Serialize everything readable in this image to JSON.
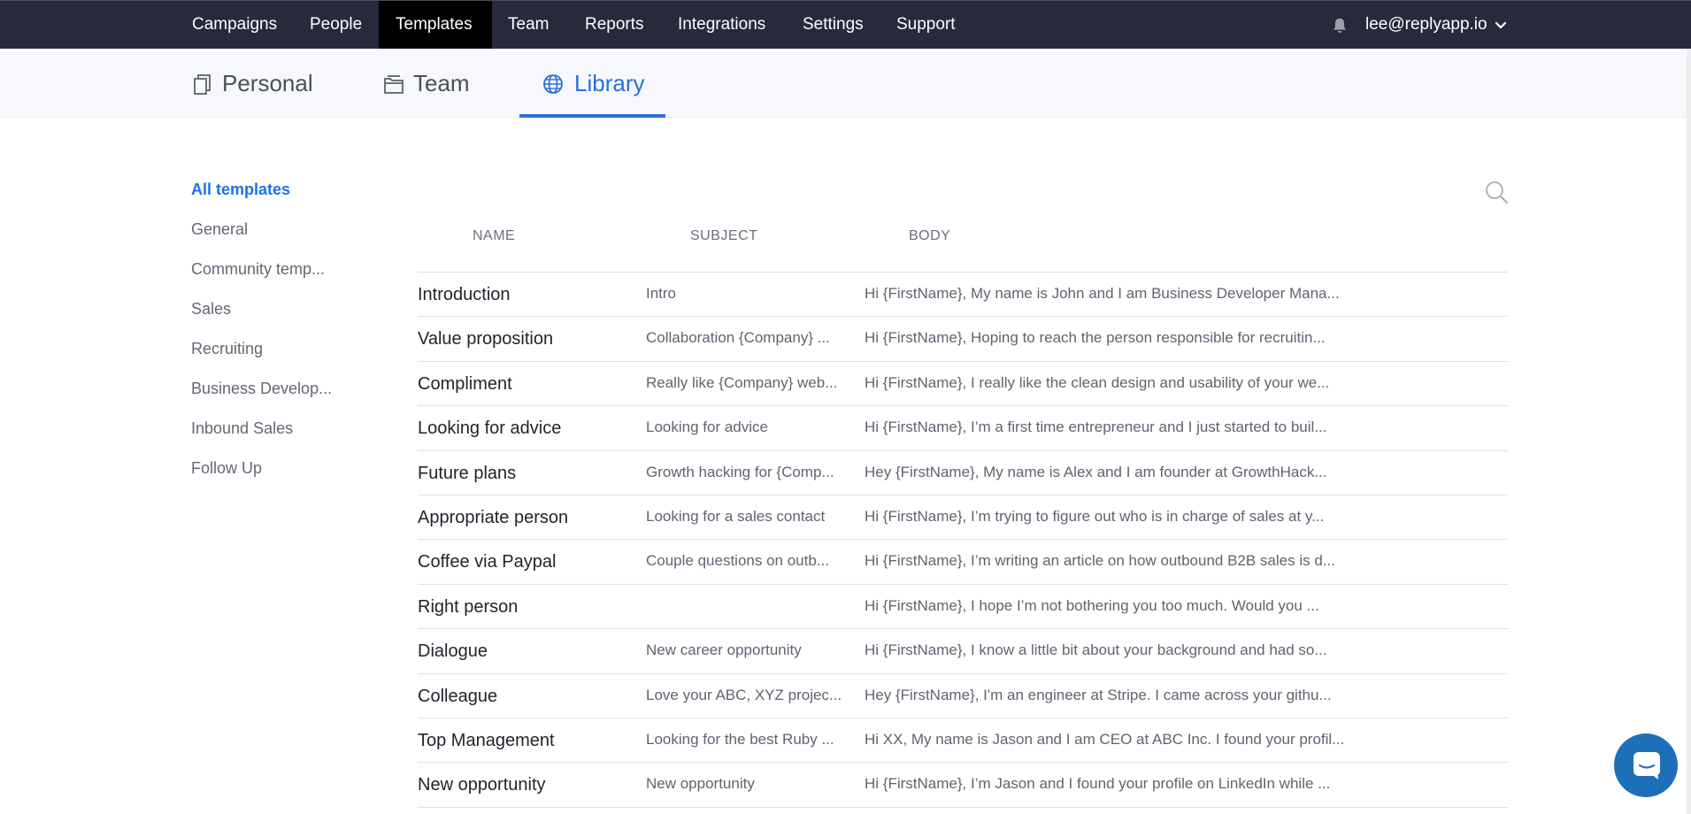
{
  "topnav": {
    "items": [
      {
        "label": "Campaigns"
      },
      {
        "label": "People"
      },
      {
        "label": "Templates"
      },
      {
        "label": "Team"
      },
      {
        "label": "Reports"
      },
      {
        "label": "Integrations"
      },
      {
        "label": "Settings"
      },
      {
        "label": "Support"
      }
    ],
    "active": "Templates",
    "user_email": "lee@replyapp.io",
    "icons": {
      "notifications": "bell-icon",
      "user_menu": "chevron-down-icon"
    }
  },
  "subtabs": {
    "items": [
      {
        "label": "Personal",
        "icon": "copy-icon"
      },
      {
        "label": "Team",
        "icon": "folder-icon"
      },
      {
        "label": "Library",
        "icon": "globe-icon"
      }
    ],
    "active": "Library"
  },
  "sidebar": {
    "items": [
      {
        "label": "All templates"
      },
      {
        "label": "General"
      },
      {
        "label": "Community temp..."
      },
      {
        "label": "Sales"
      },
      {
        "label": "Recruiting"
      },
      {
        "label": "Business Develop..."
      },
      {
        "label": "Inbound Sales"
      },
      {
        "label": "Follow Up"
      }
    ],
    "active": "All templates"
  },
  "table": {
    "columns": {
      "name": "NAME",
      "subject": "SUBJECT",
      "body": "BODY"
    },
    "rows": [
      {
        "name": "Introduction",
        "subject": "Intro",
        "body": "Hi {FirstName},  My name is John and I am Business Developer Mana..."
      },
      {
        "name": "Value proposition",
        "subject": "Collaboration {Company} ...",
        "body": "Hi {FirstName},  Hoping to reach the person responsible for recruitin..."
      },
      {
        "name": "Compliment",
        "subject": "Really like {Company} web...",
        "body": "Hi {FirstName},   I really like the clean design and usability of your we..."
      },
      {
        "name": "Looking for advice",
        "subject": "Looking for advice",
        "body": "Hi {FirstName},  I’m a first time entrepreneur and I just started to buil..."
      },
      {
        "name": "Future plans",
        "subject": "Growth hacking for {Comp...",
        "body": "Hey {FirstName},   My name is Alex and I am founder at GrowthHack..."
      },
      {
        "name": "Appropriate person",
        "subject": "Looking for a sales contact",
        "body": "Hi {FirstName},   I’m trying to figure out who is in charge of sales at y..."
      },
      {
        "name": "Coffee via Paypal",
        "subject": "Couple questions on outb...",
        "body": "Hi {FirstName},  I’m writing an article on how outbound B2B sales is d..."
      },
      {
        "name": "Right person",
        "subject": "",
        "body": "Hi {FirstName},   I hope I’m not bothering you too much. Would you ..."
      },
      {
        "name": "Dialogue",
        "subject": "New career opportunity",
        "body": "Hi {FirstName},  I know a little bit about your background and had so..."
      },
      {
        "name": "Colleague",
        "subject": "Love your ABC, XYZ projec...",
        "body": "Hey {FirstName},  I'm an engineer at Stripe. I came across your githu..."
      },
      {
        "name": "Top Management",
        "subject": "Looking for the best Ruby ...",
        "body": "Hi XX,  My name is Jason and I am CEO at ABC Inc. I found your profil..."
      },
      {
        "name": "New opportunity",
        "subject": "New opportunity",
        "body": "Hi {FirstName},  I’m Jason and I found your profile on LinkedIn while ..."
      }
    ]
  },
  "search": {
    "icon": "search-icon"
  },
  "chat": {
    "icon": "chat-icon"
  },
  "colors": {
    "topnav_bg": "#262a3a",
    "active_nav_bg": "#000000",
    "accent": "#2b6fd6",
    "chat_bg": "#1e6fb9"
  }
}
